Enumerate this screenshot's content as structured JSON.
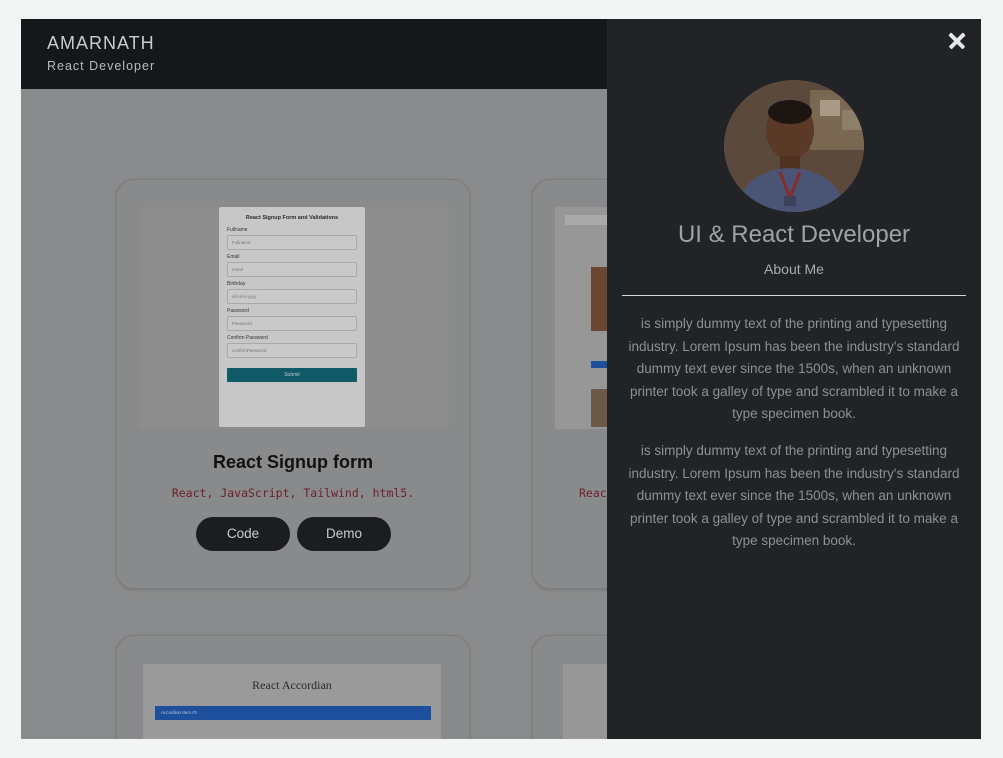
{
  "header": {
    "name": "AMARNATH",
    "role": "React Developer"
  },
  "cards": [
    {
      "title": "React Signup form",
      "tech": "React, JavaScript, Tailwind, html5.",
      "code_label": "Code",
      "demo_label": "Demo",
      "preview": {
        "heading": "React Signup Form and Validations",
        "fields": [
          {
            "label": "Fullname",
            "placeholder": "Fullname"
          },
          {
            "label": "Email",
            "placeholder": "email"
          },
          {
            "label": "Birthday",
            "placeholder": "dd-mm-yyyy"
          },
          {
            "label": "Password",
            "placeholder": "Password"
          },
          {
            "label": "Confirm Password",
            "placeholder": "confirmPassword"
          }
        ],
        "submit": "Submit"
      }
    },
    {
      "tech_partial": "Reac"
    },
    {
      "preview_title": "React Accordian",
      "preview_bar": "Accordion Item #1"
    }
  ],
  "panel": {
    "close_icon": "close-icon",
    "title": "UI & React Developer",
    "subtitle": "About Me",
    "paragraphs": [
      "is simply dummy text of the printing and typesetting industry. Lorem Ipsum has been the industry's standard dummy text ever since the 1500s, when an unknown printer took a galley of type and scrambled it to make a type specimen book.",
      "is simply dummy text of the printing and typesetting industry. Lorem Ipsum has been the industry's standard dummy text ever since the 1500s, when an unknown printer took a galley of type and scrambled it to make a type specimen book."
    ]
  },
  "colors": {
    "header_bg": "#15171b",
    "panel_bg": "#212327",
    "button_bg": "#1b1d21",
    "tech_text": "#6b1f2a"
  }
}
